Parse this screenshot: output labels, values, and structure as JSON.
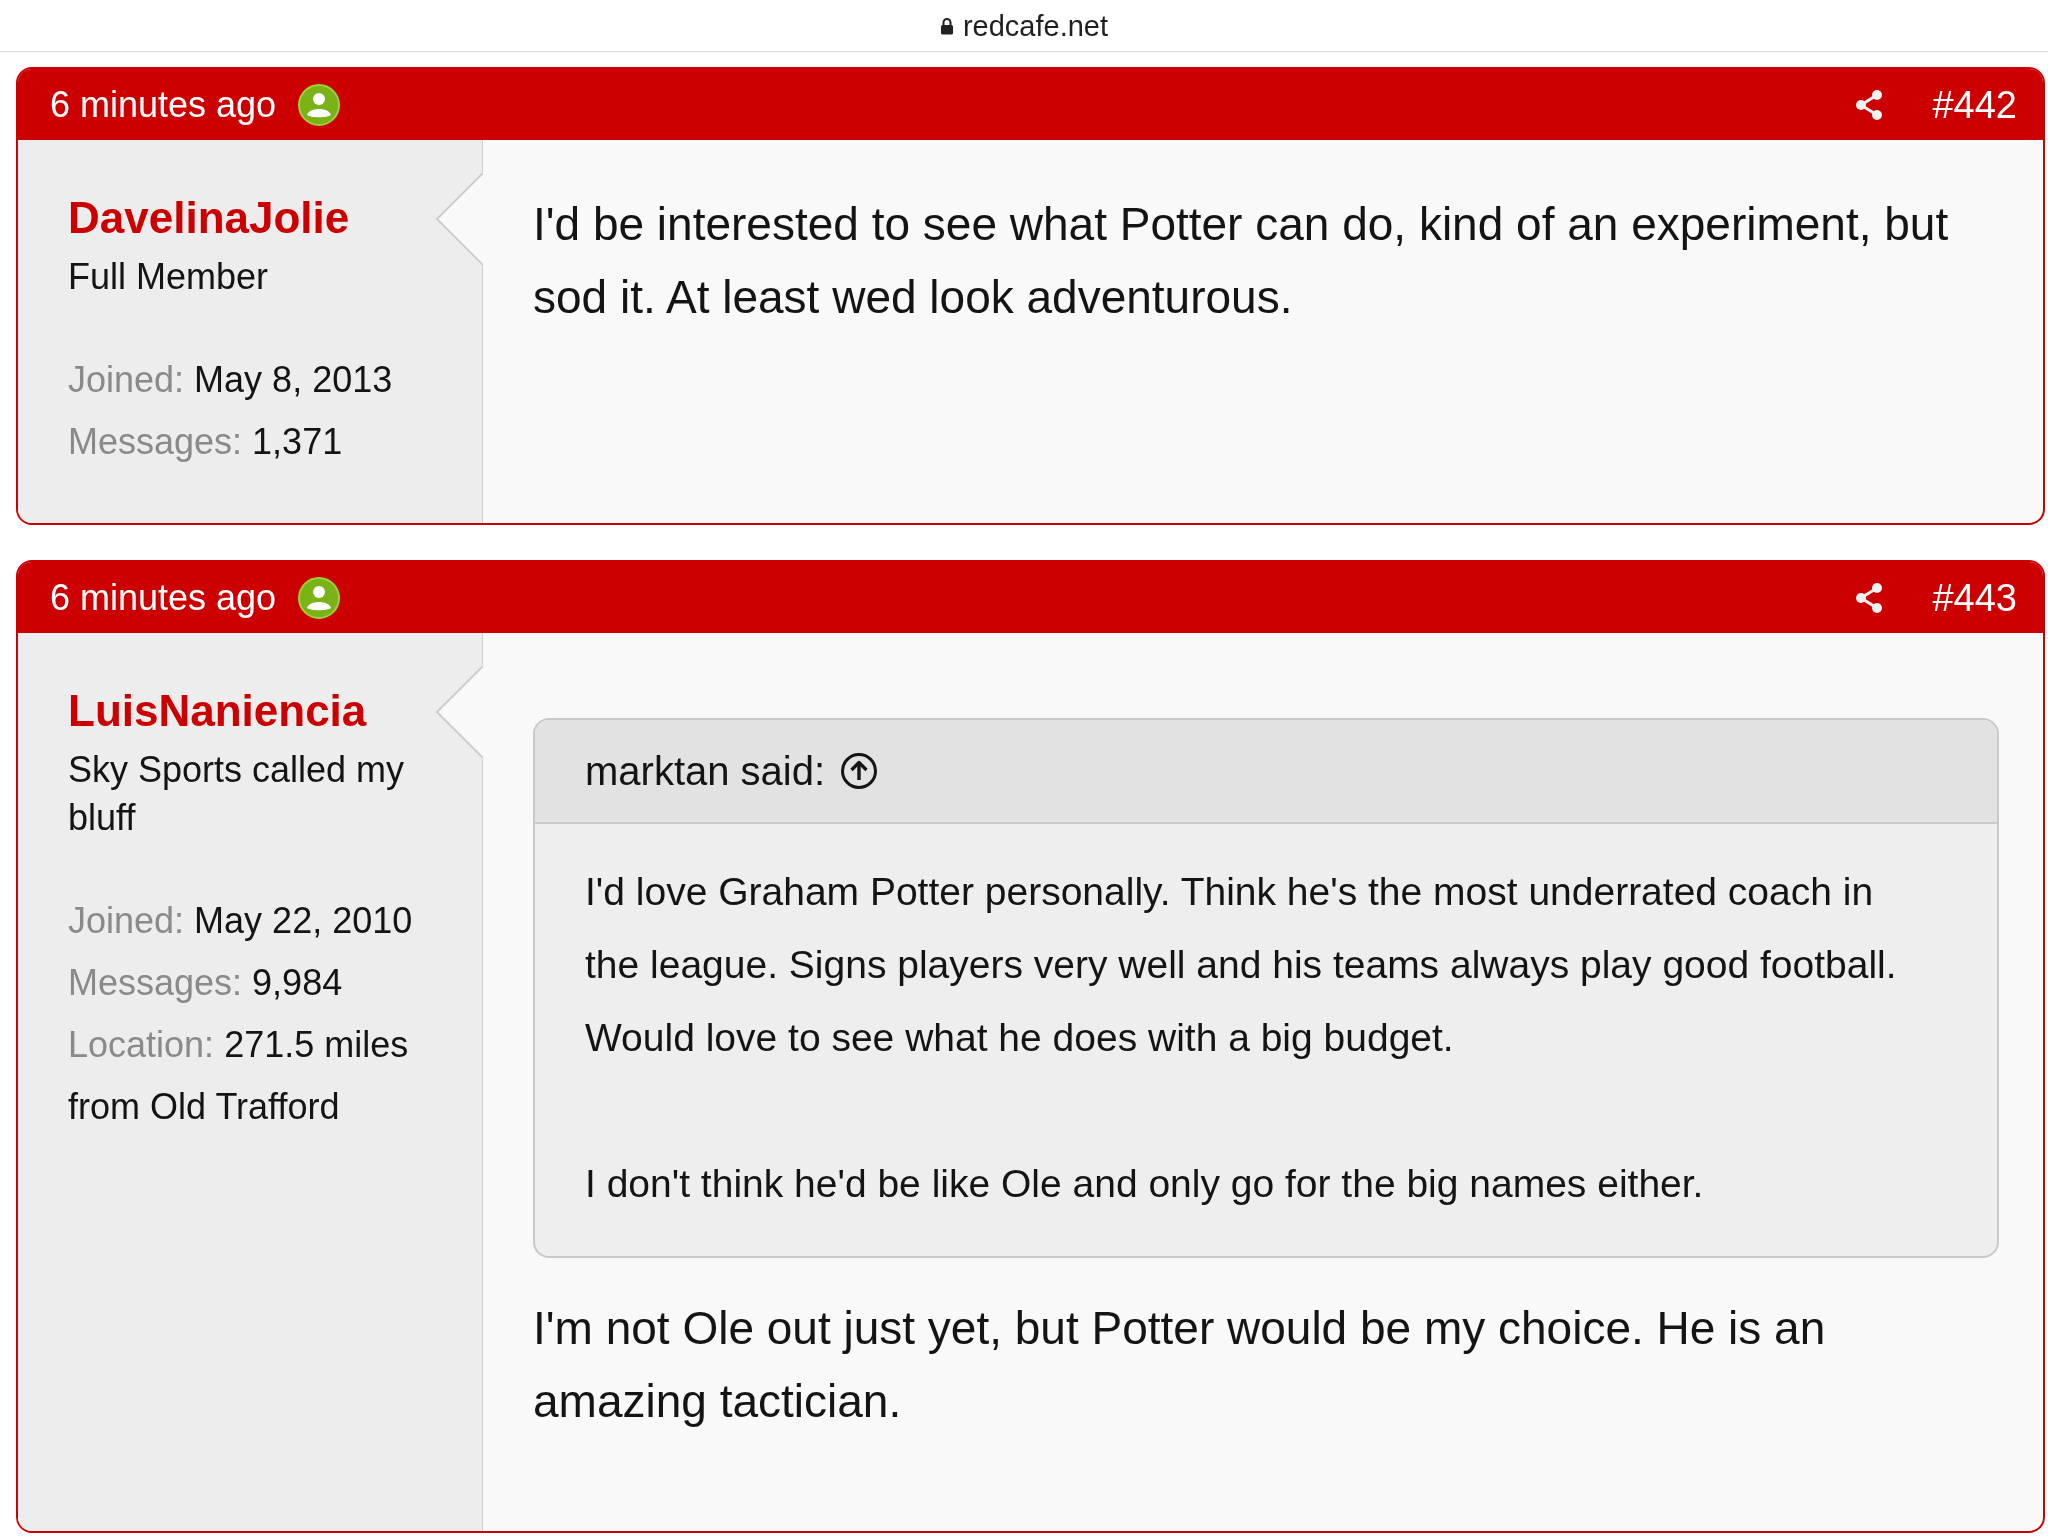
{
  "browser": {
    "url": "redcafe.net"
  },
  "posts": [
    {
      "time": "6 minutes ago",
      "number": "#442",
      "author": {
        "name": "DavelinaJolie",
        "title": "Full Member",
        "stats": [
          {
            "label": "Joined:",
            "value": "May 8, 2013"
          },
          {
            "label": "Messages:",
            "value": "1,371"
          }
        ]
      },
      "body": [
        "I'd be interested to see what Potter can do, kind of an experiment, but sod it. At least wed look adventurous."
      ]
    },
    {
      "time": "6 minutes ago",
      "number": "#443",
      "author": {
        "name": "LuisNaniencia",
        "title": "Sky Sports called my bluff",
        "stats": [
          {
            "label": "Joined:",
            "value": "May 22, 2010"
          },
          {
            "label": "Messages:",
            "value": "9,984"
          },
          {
            "label": "Location:",
            "value": "271.5 miles from Old Trafford"
          }
        ]
      },
      "quote": {
        "attribution": "marktan said:",
        "paragraphs": [
          "I'd love Graham Potter personally. Think he's the most underrated coach in the league. Signs players very well and his teams always play good football. Would love to see what he does with a big budget.",
          "I don't think he'd be like Ole and only go for the big names either."
        ]
      },
      "body": [
        "I'm not Ole out just yet, but Potter would be my choice. He is an amazing tactician."
      ]
    }
  ]
}
